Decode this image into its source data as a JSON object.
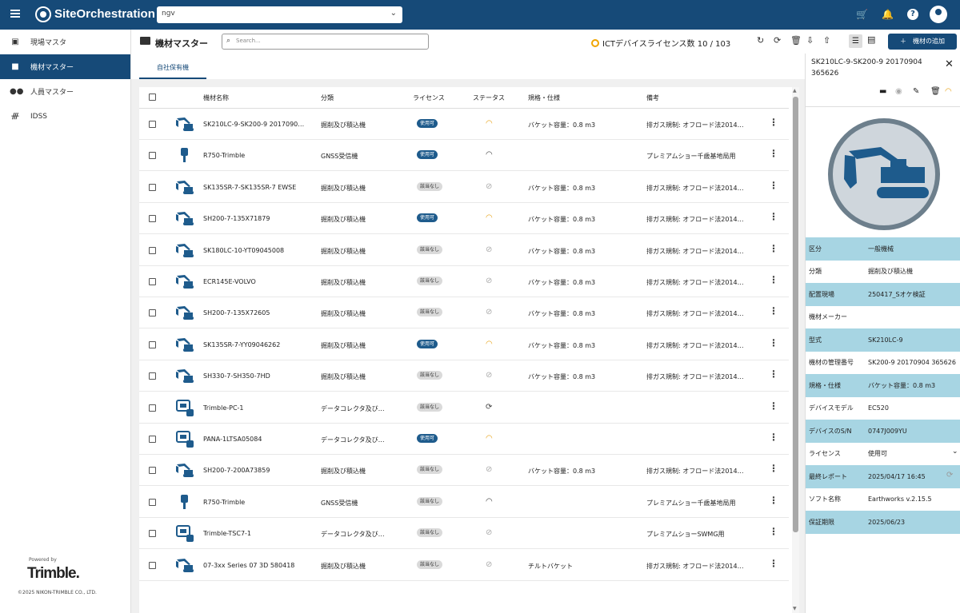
{
  "topbar": {
    "brand": "SiteOrchestration",
    "project": "ngv"
  },
  "sidebar": {
    "items": [
      {
        "label": "現場マスタ"
      },
      {
        "label": "機材マスター"
      },
      {
        "label": "人員マスター"
      },
      {
        "label": "IDSS"
      }
    ],
    "powered": "Powered by",
    "logo": "Trimble.",
    "copyright": "©2025 NIKON-TRIMBLE CO., LTD."
  },
  "header": {
    "title": "機材マスター",
    "search_placeholder": "Search...",
    "license": "ICTデバイスライセンス数 10 / 103",
    "add_label": "＋　機材の追加"
  },
  "tabs": [
    {
      "label": "自社保有機"
    }
  ],
  "table": {
    "columns": [
      "機材名称",
      "分類",
      "ライセンス",
      "ステータス",
      "規格・仕様",
      "備考"
    ],
    "rows": [
      {
        "name": "SK210LC-9-SK200-9 2017090…",
        "category": "掘削及び積込機",
        "license": "使用可",
        "lic_ok": true,
        "status": "on",
        "spec": "バケット容量：0.8 m3",
        "remark": "排ガス規制: オフロード法2014…",
        "icon": "excavator"
      },
      {
        "name": "R750-Trimble",
        "category": "GNSS受信機",
        "license": "使用可",
        "lic_ok": true,
        "status": "gray",
        "spec": "",
        "remark": "プレミアムショー千歳基地局用",
        "icon": "gnss"
      },
      {
        "name": "SK135SR-7-SK135SR-7 EWSE",
        "category": "掘削及び積込機",
        "license": "該当なし",
        "lic_ok": false,
        "status": "off",
        "spec": "バケット容量：0.8 m3",
        "remark": "排ガス規制: オフロード法2014…",
        "icon": "excavator"
      },
      {
        "name": "SH200-7-135X71879",
        "category": "掘削及び積込機",
        "license": "使用可",
        "lic_ok": true,
        "status": "on",
        "spec": "バケット容量：0.8 m3",
        "remark": "排ガス規制: オフロード法2014…",
        "icon": "excavator"
      },
      {
        "name": "SK180LC-10-YT09045008",
        "category": "掘削及び積込機",
        "license": "該当なし",
        "lic_ok": false,
        "status": "off",
        "spec": "バケット容量：0.8 m3",
        "remark": "排ガス規制: オフロード法2014…",
        "icon": "excavator"
      },
      {
        "name": "ECR145E-VOLVO",
        "category": "掘削及び積込機",
        "license": "該当なし",
        "lic_ok": false,
        "status": "off",
        "spec": "バケット容量：0.8 m3",
        "remark": "排ガス規制: オフロード法2014…",
        "icon": "excavator"
      },
      {
        "name": "SH200-7-135X72605",
        "category": "掘削及び積込機",
        "license": "該当なし",
        "lic_ok": false,
        "status": "off",
        "spec": "バケット容量：0.8 m3",
        "remark": "排ガス規制: オフロード法2014…",
        "icon": "excavator"
      },
      {
        "name": "SK135SR-7-YY09046262",
        "category": "掘削及び積込機",
        "license": "使用可",
        "lic_ok": true,
        "status": "on",
        "spec": "バケット容量：0.8 m3",
        "remark": "排ガス規制: オフロード法2014…",
        "icon": "excavator"
      },
      {
        "name": "SH330-7-SH350-7HD",
        "category": "掘削及び積込機",
        "license": "該当なし",
        "lic_ok": false,
        "status": "off",
        "spec": "バケット容量：0.8 m3",
        "remark": "排ガス規制: オフロード法2014…",
        "icon": "excavator"
      },
      {
        "name": "Trimble-PC-1",
        "category": "データコレクタ及び…",
        "license": "該当なし",
        "lic_ok": false,
        "status": "sync",
        "spec": "",
        "remark": "",
        "icon": "collector"
      },
      {
        "name": "PANA-1LTSA05084",
        "category": "データコレクタ及び…",
        "license": "使用可",
        "lic_ok": true,
        "status": "on",
        "spec": "",
        "remark": "",
        "icon": "collector"
      },
      {
        "name": "SH200-7-200A73859",
        "category": "掘削及び積込機",
        "license": "該当なし",
        "lic_ok": false,
        "status": "off",
        "spec": "バケット容量：0.8 m3",
        "remark": "排ガス規制: オフロード法2014…",
        "icon": "excavator"
      },
      {
        "name": "R750-Trimble",
        "category": "GNSS受信機",
        "license": "該当なし",
        "lic_ok": false,
        "status": "gray",
        "spec": "",
        "remark": "プレミアムショー千歳基地局用",
        "icon": "gnss"
      },
      {
        "name": "Trimble-TSC7-1",
        "category": "データコレクタ及び…",
        "license": "該当なし",
        "lic_ok": false,
        "status": "off",
        "spec": "",
        "remark": "プレミアムショーSWMG用",
        "icon": "collector"
      },
      {
        "name": "07-3xx Series 07 3D 580418",
        "category": "掘削及び積込機",
        "license": "該当なし",
        "lic_ok": false,
        "status": "off",
        "spec": "チルトバケット",
        "remark": "排ガス規制: オフロード法2014…",
        "icon": "excavator"
      }
    ]
  },
  "detail": {
    "title": "SK210LC-9-SK200-9 20170904 365626",
    "rows": [
      {
        "k": "区分",
        "v": "一般機械"
      },
      {
        "k": "分類",
        "v": "掘削及び積込機"
      },
      {
        "k": "配置現場",
        "v": "250417_Sオケ検証"
      },
      {
        "k": "機材メーカー",
        "v": ""
      },
      {
        "k": "型式",
        "v": "SK210LC-9"
      },
      {
        "k": "機材の管理番号",
        "v": "SK200-9 20170904 365626"
      },
      {
        "k": "規格・仕様",
        "v": "バケット容量：0.8 m3"
      },
      {
        "k": "デバイスモデル",
        "v": "EC520"
      },
      {
        "k": "デバイスのS/N",
        "v": "0747J009YU"
      },
      {
        "k": "ライセンス",
        "v": "使用可"
      },
      {
        "k": "最終レポート",
        "v": "2025/04/17 16:45"
      },
      {
        "k": "ソフト名称",
        "v": "Earthworks v.2.15.5"
      },
      {
        "k": "保証期限",
        "v": "2025/06/23"
      }
    ]
  },
  "colors": {
    "primary": "#164a78",
    "accent": "#e8a317",
    "highlight": "#a7d5e3"
  }
}
